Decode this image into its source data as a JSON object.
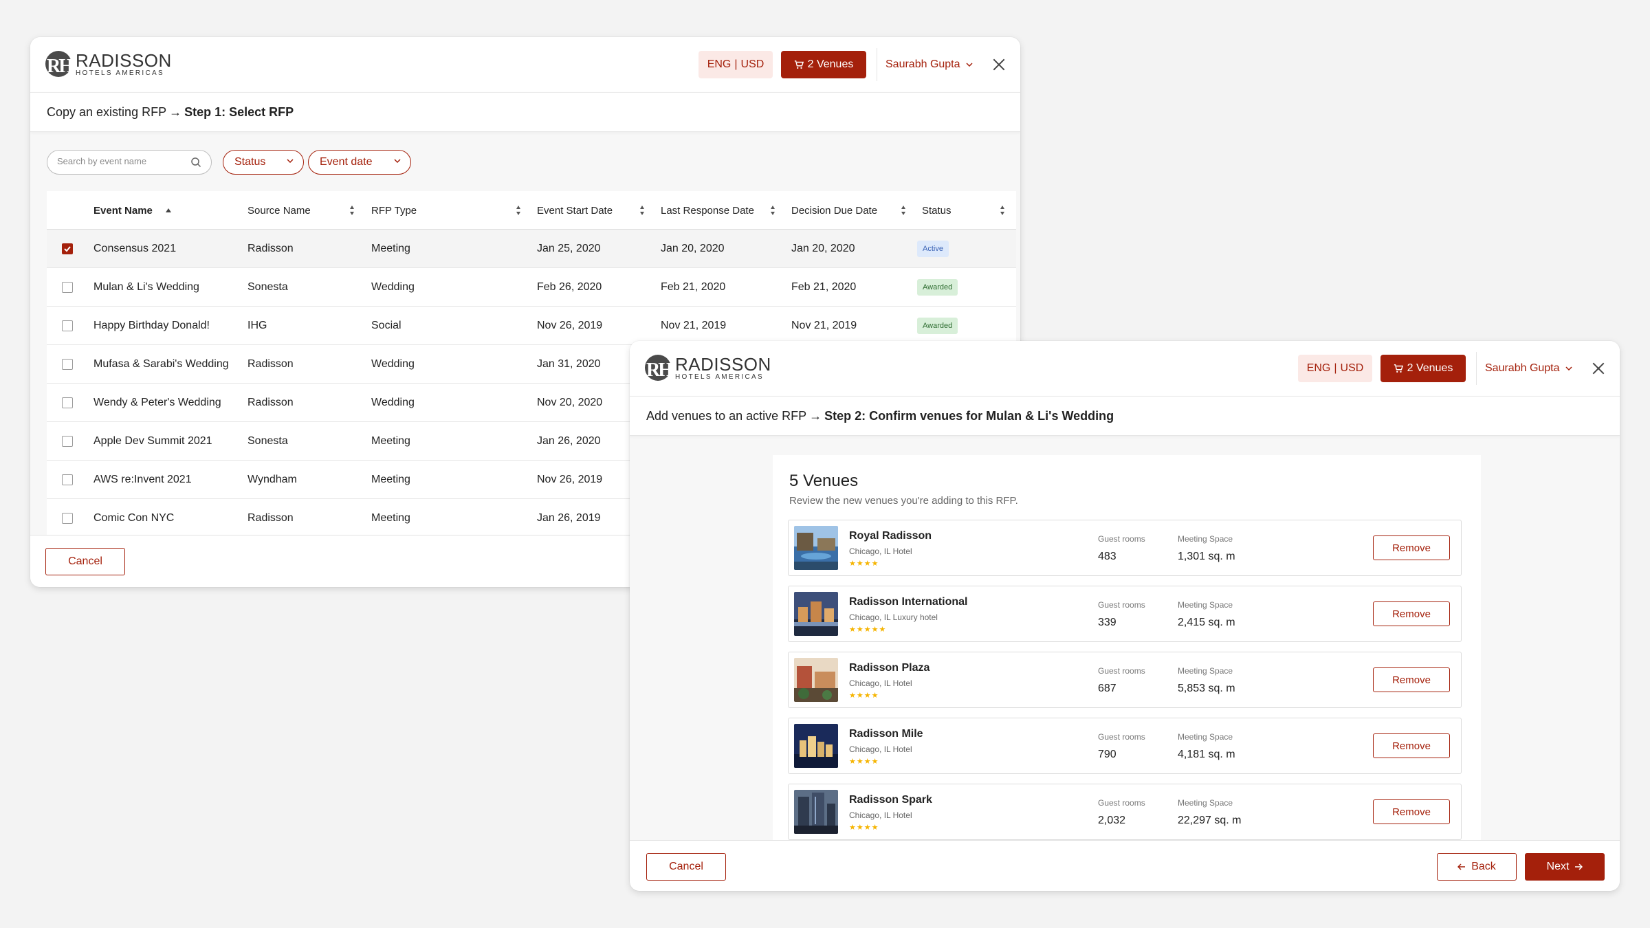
{
  "brand": {
    "name": "RADISSON",
    "sub": "HOTELS AMERICAS",
    "mark": "RH"
  },
  "colors": {
    "accent": "#a4200b",
    "accent_light": "#fbe9e6",
    "active_badge": "#dde9fb",
    "awarded_badge": "#d8efd9",
    "star": "#f5b400"
  },
  "header": {
    "lang": "ENG",
    "currency": "USD",
    "venues_label": "2 Venues",
    "user_name": "Saurabh Gupta"
  },
  "step1": {
    "prefix": "Copy an existing RFP",
    "step_label": "Step 1: Select RFP",
    "search_placeholder": "Search by event name",
    "filter_status": "Status",
    "filter_date": "Event date",
    "columns": {
      "event_name": "Event Name",
      "source_name": "Source Name",
      "rfp_type": "RFP Type",
      "event_start": "Event Start Date",
      "last_response": "Last Response Date",
      "decision_due": "Decision Due Date",
      "status": "Status"
    },
    "rows": [
      {
        "name": "Consensus 2021",
        "source": "Radisson",
        "type": "Meeting",
        "start": "Jan 25, 2020",
        "last": "Jan 20, 2020",
        "due": "Jan 20, 2020",
        "status": "Active",
        "checked": true
      },
      {
        "name": "Mulan & Li's Wedding",
        "source": "Sonesta",
        "type": "Wedding",
        "start": "Feb 26, 2020",
        "last": "Feb 21, 2020",
        "due": "Feb 21, 2020",
        "status": "Awarded",
        "checked": false
      },
      {
        "name": "Happy Birthday Donald!",
        "source": "IHG",
        "type": "Social",
        "start": "Nov 26, 2019",
        "last": "Nov 21, 2019",
        "due": "Nov 21, 2019",
        "status": "Awarded",
        "checked": false
      },
      {
        "name": "Mufasa & Sarabi's Wedding",
        "source": "Radisson",
        "type": "Wedding",
        "start": "Jan 31, 2020",
        "checked": false
      },
      {
        "name": "Wendy & Peter's Wedding",
        "source": "Radisson",
        "type": "Wedding",
        "start": "Nov 20, 2020",
        "checked": false
      },
      {
        "name": "Apple Dev Summit 2021",
        "source": "Sonesta",
        "type": "Meeting",
        "start": "Jan 26, 2020",
        "checked": false
      },
      {
        "name": "AWS re:Invent 2021",
        "source": "Wyndham",
        "type": "Meeting",
        "start": "Nov 26, 2019",
        "checked": false
      },
      {
        "name": "Comic Con NYC",
        "source": "Radisson",
        "type": "Meeting",
        "start": "Jan 26, 2019",
        "checked": false
      }
    ],
    "cancel_label": "Cancel"
  },
  "step2": {
    "prefix": "Add venues to an active RFP",
    "step_label": "Step 2: Confirm venues for Mulan & Li's Wedding",
    "heading": "5 Venues",
    "subheading": "Review the new venues you're adding to this RFP.",
    "guest_rooms_label": "Guest rooms",
    "meeting_space_label": "Meeting Space",
    "remove_label": "Remove",
    "venues": [
      {
        "name": "Royal Radisson",
        "location": "Chicago, IL Hotel",
        "stars": "★★★★",
        "rooms": "483",
        "space": "1,301 sq. m"
      },
      {
        "name": "Radisson International",
        "location": "Chicago, IL Luxury hotel",
        "stars": "★★★★★",
        "rooms": "339",
        "space": "2,415 sq. m"
      },
      {
        "name": "Radisson Plaza",
        "location": "Chicago, IL Hotel",
        "stars": "★★★★",
        "rooms": "687",
        "space": "5,853 sq. m"
      },
      {
        "name": "Radisson Mile",
        "location": "Chicago, IL Hotel",
        "stars": "★★★★",
        "rooms": "790",
        "space": "4,181 sq. m"
      },
      {
        "name": "Radisson Spark",
        "location": "Chicago, IL Hotel",
        "stars": "★★★★",
        "rooms": "2,032",
        "space": "22,297 sq. m"
      }
    ],
    "cancel_label": "Cancel",
    "back_label": "Back",
    "next_label": "Next"
  },
  "icons": {
    "cart": "cart-icon",
    "close": "close-icon",
    "search": "search-icon",
    "chevron": "chevron-down-icon",
    "sort": "sort-icon",
    "arrow_left": "arrow-left-icon",
    "arrow_right": "arrow-right-icon"
  }
}
